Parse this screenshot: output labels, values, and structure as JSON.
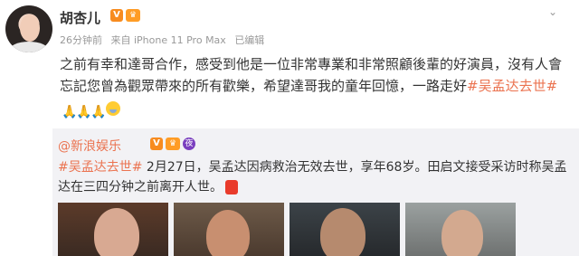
{
  "post": {
    "username": "胡杏儿",
    "vip_badge": "V",
    "level_badge": "♛",
    "meta": {
      "time": "26分钟前",
      "source": "来自 iPhone 11 Pro Max",
      "edited": "已编辑"
    },
    "text_part1": "之前有幸和達哥合作，感受到他是一位非常專業和非常照顧後輩的好演員，沒有人會忘記您曾為觀眾帶來的所有歡樂，希望達哥我的童年回憶，一路走好",
    "hashtag": "#吴孟达去世#",
    "emoji_pray": "🙏",
    "emoji_cry": "cry-face-icon"
  },
  "repost": {
    "author": "@新浪娱乐",
    "vip_badge": "V",
    "level_badge": "♛",
    "badge2": "夜",
    "hashtag": "#吴孟达去世#",
    "text": " 2月27日，吴孟达因病救治无效去世，享年68岁。田启文接受采访时称吴孟达在三四分钟之前离开人世。",
    "photos": [
      "photo-1",
      "photo-2",
      "photo-3",
      "photo-4"
    ]
  },
  "colors": {
    "accent": "#eb7350",
    "text": "#333333",
    "meta": "#999999",
    "repost_bg": "#f2f2f5"
  }
}
